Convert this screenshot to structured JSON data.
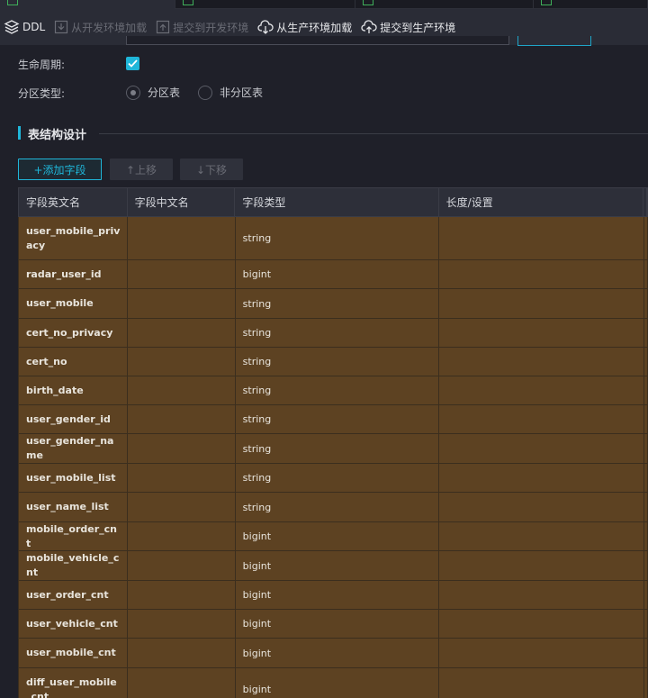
{
  "toolbar": {
    "ddl": "DDL",
    "load_dev": "从开发环境加载",
    "submit_dev": "提交到开发环境",
    "load_prod": "从生产环境加载",
    "submit_prod": "提交到生产环境"
  },
  "form": {
    "lifecycle_label": "生命周期:",
    "partition_label": "分区类型:",
    "partition_options": [
      "分区表",
      "非分区表"
    ],
    "lifecycle_checked": true,
    "selected_partition": "分区表"
  },
  "section": {
    "title": "表结构设计"
  },
  "actions": {
    "add": "+添加字段",
    "up": "↑上移",
    "down": "↓下移"
  },
  "table": {
    "headers": [
      "字段英文名",
      "字段中文名",
      "字段类型",
      "长度/设置"
    ],
    "rows": [
      {
        "name": "user_mobile_privacy",
        "cn": "",
        "type": "string",
        "len": ""
      },
      {
        "name": "radar_user_id",
        "cn": "",
        "type": "bigint",
        "len": ""
      },
      {
        "name": "user_mobile",
        "cn": "",
        "type": "string",
        "len": ""
      },
      {
        "name": "cert_no_privacy",
        "cn": "",
        "type": "string",
        "len": ""
      },
      {
        "name": "cert_no",
        "cn": "",
        "type": "string",
        "len": ""
      },
      {
        "name": "birth_date",
        "cn": "",
        "type": "string",
        "len": ""
      },
      {
        "name": "user_gender_id",
        "cn": "",
        "type": "string",
        "len": ""
      },
      {
        "name": "user_gender_name",
        "cn": "",
        "type": "string",
        "len": ""
      },
      {
        "name": "user_mobile_list",
        "cn": "",
        "type": "string",
        "len": ""
      },
      {
        "name": "user_name_list",
        "cn": "",
        "type": "string",
        "len": ""
      },
      {
        "name": "mobile_order_cnt",
        "cn": "",
        "type": "bigint",
        "len": ""
      },
      {
        "name": "mobile_vehicle_cnt",
        "cn": "",
        "type": "bigint",
        "len": ""
      },
      {
        "name": "user_order_cnt",
        "cn": "",
        "type": "bigint",
        "len": ""
      },
      {
        "name": "user_vehicle_cnt",
        "cn": "",
        "type": "bigint",
        "len": ""
      },
      {
        "name": "user_mobile_cnt",
        "cn": "",
        "type": "bigint",
        "len": ""
      },
      {
        "name": "diff_user_mobile_cnt",
        "cn": "",
        "type": "bigint",
        "len": ""
      }
    ]
  },
  "colors": {
    "accent": "#1fb6d9",
    "row_bg": "#5d4222",
    "toolbar_bg": "#2a2c36",
    "page_bg": "#1f2029"
  }
}
